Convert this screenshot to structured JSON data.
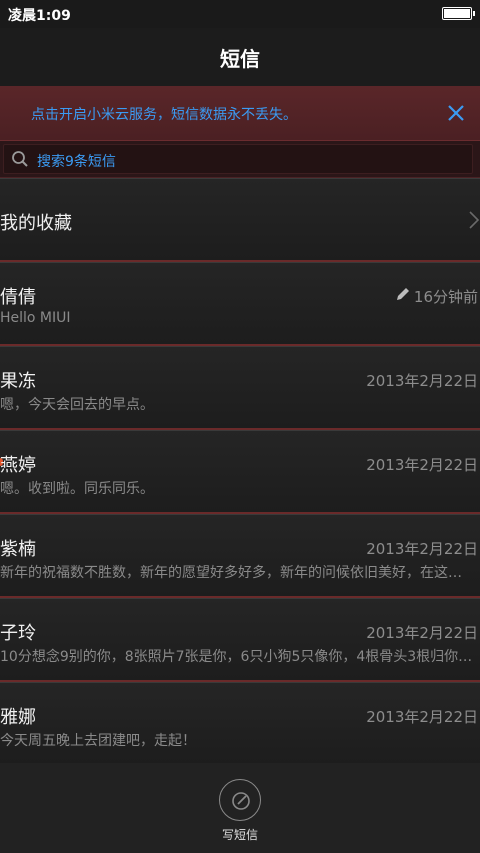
{
  "status_bar": {
    "time": "凌晨1:09"
  },
  "header": {
    "title": "短信"
  },
  "banner": {
    "text": "点击开启小米云服务，短信数据永不丢失。"
  },
  "search": {
    "placeholder": "搜索9条短信"
  },
  "favorites": {
    "label": "我的收藏"
  },
  "conversations": [
    {
      "name": "倩倩",
      "date": "16分钟前",
      "preview": "Hello MIUI",
      "draft": true
    },
    {
      "name": "果冻",
      "date": "2013年2月22日",
      "preview": "嗯，今天会回去的早点。"
    },
    {
      "name": "燕婷",
      "date": "2013年2月22日",
      "preview": "嗯。收到啦。同乐同乐。",
      "unread": true
    },
    {
      "name": "紫楠",
      "date": "2013年2月22日",
      "preview": "新年的祝福数不胜数，新年的愿望好多好多，新年的问候依旧美好，在这…"
    },
    {
      "name": "子玲",
      "date": "2013年2月22日",
      "preview": "10分想念9别的你，8张照片7张是你，6只小狗5只像你，4根骨头3根归你…"
    },
    {
      "name": "雅娜",
      "date": "2013年2月22日",
      "preview": "今天周五晚上去团建吧，走起！"
    }
  ],
  "bottom": {
    "compose_label": "写短信"
  },
  "colors": {
    "accent": "#3b9bf3",
    "banner_bg": "#5a2629",
    "unread": "#e3552d"
  }
}
